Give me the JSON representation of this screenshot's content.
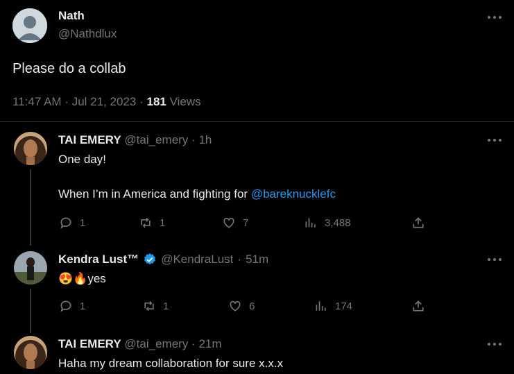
{
  "original": {
    "name": "Nath",
    "handle": "@Nathdlux",
    "text": "Please do a collab",
    "time": "11:47 AM",
    "date": "Jul 21, 2023",
    "views_count": "181",
    "views_label": "Views",
    "sep": "·"
  },
  "replies": [
    {
      "name": "TAI EMERY",
      "handle": "@tai_emery",
      "age": "1h",
      "line1": "One day!",
      "line2": "When I’m in America and fighting for",
      "mention": "@bareknucklefc",
      "replies": "1",
      "reposts": "1",
      "likes": "7",
      "views": "3,488"
    },
    {
      "name": "Kendra Lust™",
      "handle": "@KendraLust",
      "age": "51m",
      "emoji": "😍🔥",
      "text": "yes",
      "replies": "1",
      "reposts": "1",
      "likes": "6",
      "views": "174",
      "verified_color": "#1d9bf0"
    },
    {
      "name": "TAI EMERY",
      "handle": "@tai_emery",
      "age": "21m",
      "text": "Haha my dream collaboration for sure x.x.x"
    }
  ],
  "colors": {
    "background": "#000000",
    "text": "#e7e9ea",
    "muted": "#71767b",
    "link": "#1d9bf0",
    "divider": "#2f3336"
  },
  "icons": [
    "more-icon",
    "reply-icon",
    "repost-icon",
    "like-icon",
    "views-icon",
    "share-icon",
    "verified-icon"
  ]
}
